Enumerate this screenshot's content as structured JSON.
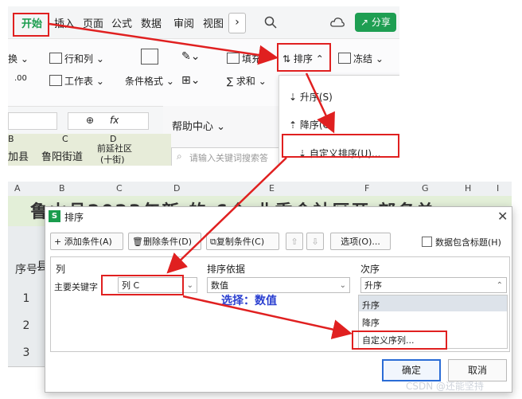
{
  "ribbon": {
    "tabs": [
      "开始",
      "插入",
      "页面",
      "公式",
      "数据",
      "审阅",
      "视图"
    ],
    "more_glyph": "›",
    "share_label": "分享",
    "tools": {
      "huan": "换",
      "hang_lie": "行和列",
      "fill": "填充",
      "sort": "排序",
      "freeze": "冻结",
      "worksheet": "工作表",
      "cond_format": "条件格式",
      "sum": "求和",
      "decimal": ".00"
    },
    "fx_label": "fx",
    "help_center": "帮助中心",
    "search_placeholder": "请输入关键词搜索答",
    "grid_snippet": {
      "cols": [
        "B",
        "C",
        "D"
      ],
      "cells": [
        "加县",
        "鲁阳街道",
        "前延社区",
        "(十街)"
      ]
    }
  },
  "sort_menu": {
    "items": [
      "升序(S)",
      "降序(O)",
      "自定义排序(U)..."
    ]
  },
  "sheet": {
    "columns": [
      "A",
      "B",
      "C",
      "D",
      "E",
      "F",
      "G",
      "H",
      "I"
    ],
    "banner": "鲁山县2023年新   的 6个  业委会社区开  部名单",
    "row_header_label": "序号",
    "row_header_col2": "县",
    "rows": [
      "1",
      "2",
      "3"
    ]
  },
  "dialog": {
    "icon_text": "S",
    "title": "排序",
    "buttons": {
      "add": "+ 添加条件(A)",
      "delete": "删除条件(D)",
      "copy": "复制条件(C)",
      "options": "选项(O)...",
      "ok": "确定",
      "cancel": "取消"
    },
    "checkbox_label": "数据包含标题(H)",
    "headers": {
      "col": "列",
      "basis": "排序依据",
      "order": "次序"
    },
    "row": {
      "key_label": "主要关键字",
      "column": "列 C",
      "basis": "数值",
      "order": "升序"
    },
    "order_options": [
      "升序",
      "降序",
      "自定义序列..."
    ]
  },
  "annotation": "选择：数值",
  "watermark": "CSDN @还能坚持",
  "colors": {
    "accent_red": "#e02020",
    "brand_green": "#1e9e52",
    "annot_blue": "#2a3fd0"
  }
}
